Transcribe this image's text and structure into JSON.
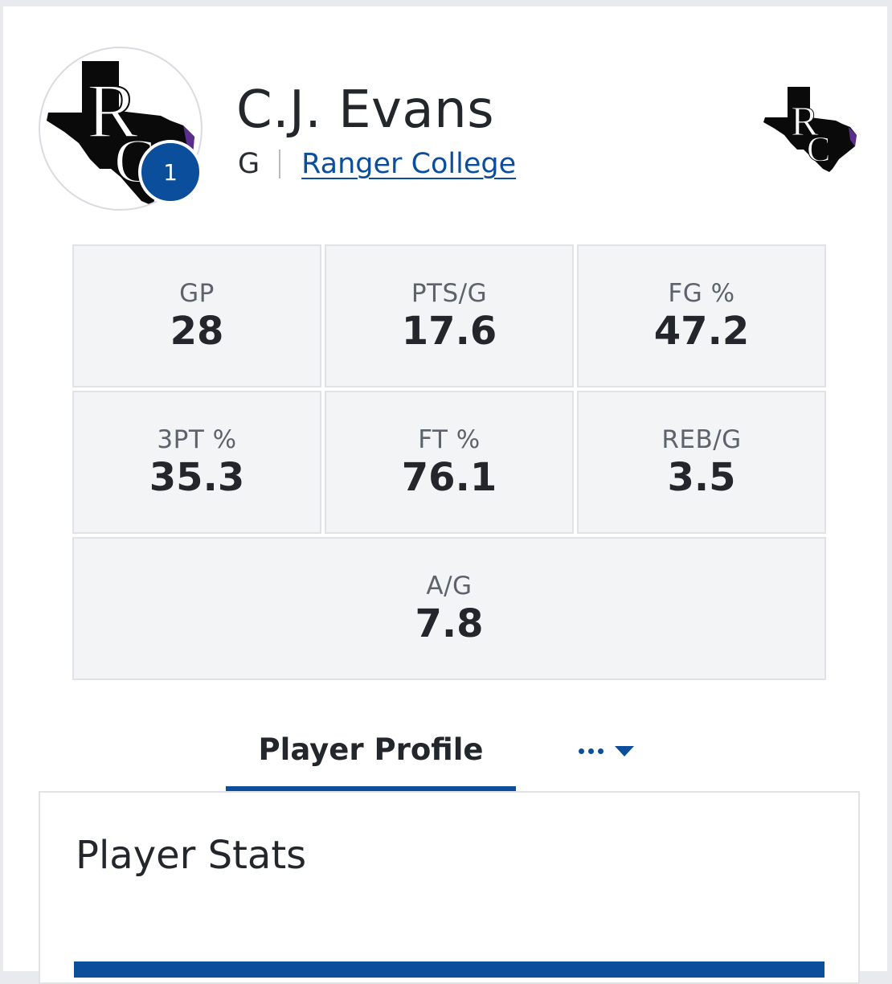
{
  "player": {
    "name": "C.J. Evans",
    "position": "G",
    "team": "Ranger College",
    "number": "1",
    "logo_text": "RC"
  },
  "stats": [
    {
      "label": "GP",
      "value": "28"
    },
    {
      "label": "PTS/G",
      "value": "17.6"
    },
    {
      "label": "FG %",
      "value": "47.2"
    },
    {
      "label": "3PT %",
      "value": "35.3"
    },
    {
      "label": "FT %",
      "value": "76.1"
    },
    {
      "label": "REB/G",
      "value": "3.5"
    },
    {
      "label": "A/G",
      "value": "7.8"
    }
  ],
  "tabs": {
    "active": "Player Profile",
    "more_icon": "ellipsis-icon",
    "dropdown_icon": "caret-down-icon"
  },
  "section": {
    "title": "Player Stats"
  },
  "colors": {
    "accent": "#0b4f9c",
    "cell_bg": "#f3f4f6",
    "page_bg": "#e9eaee"
  }
}
